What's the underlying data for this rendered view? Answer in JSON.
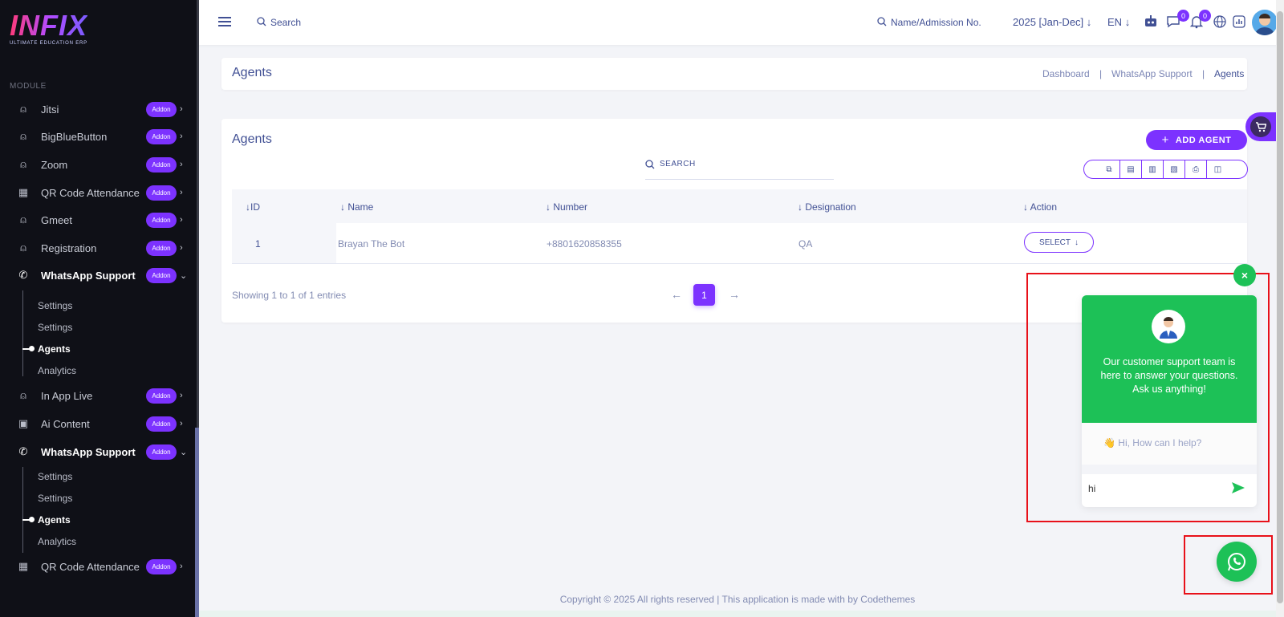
{
  "brand": {
    "logo": "INFIX",
    "tagline": "ULTIMATE EDUCATION ERP"
  },
  "sidebar": {
    "module_title": "MODULE",
    "items": [
      {
        "label": "Jitsi",
        "badge": "Addon",
        "icon": "user-icon"
      },
      {
        "label": "BigBlueButton",
        "badge": "Addon",
        "icon": "user-icon"
      },
      {
        "label": "Zoom",
        "badge": "Addon",
        "icon": "user-icon"
      },
      {
        "label": "QR Code Attendance",
        "badge": "Addon",
        "icon": "qr-icon"
      },
      {
        "label": "Gmeet",
        "badge": "Addon",
        "icon": "user-icon"
      },
      {
        "label": "Registration",
        "badge": "Addon",
        "icon": "user-icon"
      },
      {
        "label": "WhatsApp Support",
        "badge": "Addon",
        "icon": "whatsapp-icon",
        "sub": [
          "Settings",
          "Settings",
          "Agents",
          "Analytics"
        ]
      },
      {
        "label": "In App Live",
        "badge": "Addon",
        "icon": "user-icon"
      },
      {
        "label": "Ai Content",
        "badge": "Addon",
        "icon": "robot-icon"
      },
      {
        "label": "WhatsApp Support",
        "badge": "Addon",
        "icon": "whatsapp-icon",
        "sub": [
          "Settings",
          "Settings",
          "Agents",
          "Analytics"
        ]
      },
      {
        "label": "QR Code Attendance",
        "badge": "Addon",
        "icon": "qr-icon"
      }
    ]
  },
  "topbar": {
    "search_placeholder": "Search",
    "student_search": "Name/Admission No.",
    "session": "2025 [Jan-Dec]",
    "language": "EN",
    "chat_badge": "0",
    "notif_badge": "0"
  },
  "header": {
    "title": "Agents",
    "breadcrumb": [
      "Dashboard",
      "WhatsApp Support",
      "Agents"
    ]
  },
  "agents_card": {
    "title": "Agents",
    "add_button": "ADD AGENT",
    "search_placeholder": "SEARCH",
    "columns": [
      "ID",
      "Name",
      "Number",
      "Designation",
      "Action"
    ],
    "rows": [
      {
        "id": "1",
        "name": "Brayan The Bot",
        "number": "+8801620858355",
        "designation": "QA",
        "action": "SELECT"
      }
    ],
    "footer": "Showing 1 to 1 of 1 entries",
    "current_page": "1"
  },
  "chat_widget": {
    "message": "Our customer support team is here to answer your questions. Ask us anything!",
    "greeting": "Hi, How can I help?",
    "input_value": "hi"
  },
  "footer": {
    "copyright": "Copyright © 2025 All rights reserved | This application is made with by Codethemes"
  },
  "colors": {
    "accent": "#7c32ff",
    "whatsapp": "#1dc157",
    "highlight": "#e8111a",
    "sidebar_bg": "#0f1017"
  }
}
